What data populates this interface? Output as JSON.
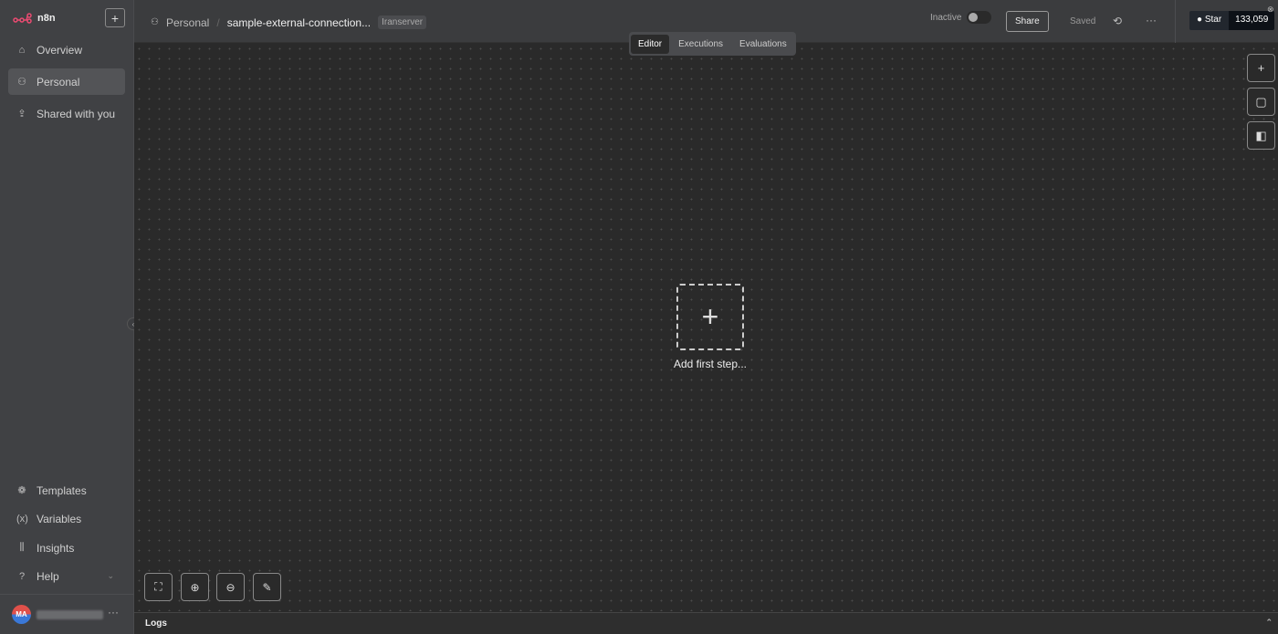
{
  "sidebar": {
    "brand": "n8n",
    "new_label": "+",
    "items": [
      {
        "label": "Overview",
        "icon": "home-icon"
      },
      {
        "label": "Personal",
        "icon": "user-icon"
      },
      {
        "label": "Shared with you",
        "icon": "share-icon"
      }
    ],
    "bottom_items": [
      {
        "label": "Templates"
      },
      {
        "label": "Variables"
      },
      {
        "label": "Insights"
      },
      {
        "label": "Help"
      }
    ],
    "user_initials": "MA"
  },
  "header": {
    "project": "Personal",
    "workflow": "sample-external-connection...",
    "tag": "Iranserver",
    "status": "Inactive",
    "share": "Share",
    "saved": "Saved",
    "github_star": "Star",
    "github_count": "133,059"
  },
  "tabs": [
    "Editor",
    "Executions",
    "Evaluations"
  ],
  "canvas": {
    "add_first_step": "Add first step..."
  },
  "logs": {
    "label": "Logs"
  }
}
